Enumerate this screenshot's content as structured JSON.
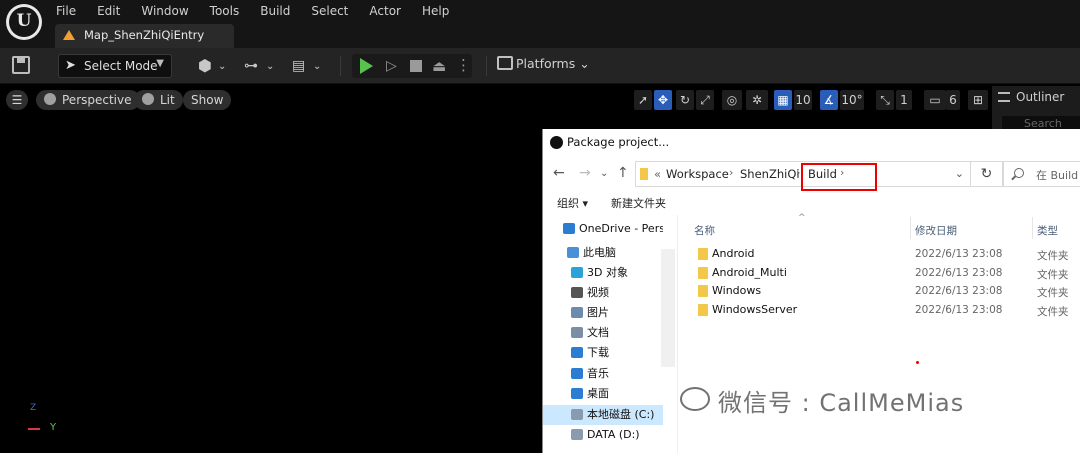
{
  "menu": [
    "File",
    "Edit",
    "Window",
    "Tools",
    "Build",
    "Select",
    "Actor",
    "Help"
  ],
  "level_tab": "Map_ShenZhiQiEntry",
  "toolbar": {
    "select_mode": "Select Mode",
    "platforms": "Platforms"
  },
  "viewport": {
    "perspective": "Perspective",
    "lit": "Lit",
    "show": "Show",
    "grid_snap": "10",
    "rotation_snap": "10°",
    "scale_snap": "1",
    "camera_speed": "6"
  },
  "outliner": {
    "title": "Outliner",
    "search_placeholder": "Search"
  },
  "axis": {
    "y": "Y",
    "z": "Z"
  },
  "dialog": {
    "title": "Package project...",
    "breadcrumb": [
      "«",
      "Workspace",
      "ShenZhiQi",
      "Build"
    ],
    "search_placeholder": "在 Build 中",
    "commands": {
      "organize": "组织 ▾",
      "new_folder": "新建文件夹"
    },
    "nav_pane": [
      {
        "label": "OneDrive - Persc",
        "icon": "cloud-icon",
        "color": "#2b7cd3"
      },
      {
        "label": "此电脑",
        "icon": "computer-icon",
        "color": "#4a90d9"
      },
      {
        "label": "3D 对象",
        "icon": "3d-objects-icon",
        "color": "#29a3d8"
      },
      {
        "label": "视频",
        "icon": "video-icon",
        "color": "#555555"
      },
      {
        "label": "图片",
        "icon": "pictures-icon",
        "color": "#6b8cae"
      },
      {
        "label": "文档",
        "icon": "documents-icon",
        "color": "#7a8ea4"
      },
      {
        "label": "下载",
        "icon": "download-icon",
        "color": "#2b7cd3"
      },
      {
        "label": "音乐",
        "icon": "music-icon",
        "color": "#2b7cd3"
      },
      {
        "label": "桌面",
        "icon": "desktop-icon",
        "color": "#2b7cd3"
      },
      {
        "label": "本地磁盘 (C:)",
        "icon": "drive-icon",
        "color": "#8a9bb0"
      },
      {
        "label": "DATA (D:)",
        "icon": "drive-icon",
        "color": "#8a9bb0"
      }
    ],
    "columns": {
      "name": "名称",
      "date": "修改日期",
      "type": "类型"
    },
    "files": [
      {
        "name": "Android",
        "date": "2022/6/13 23:08",
        "type": "文件夹"
      },
      {
        "name": "Android_Multi",
        "date": "2022/6/13 23:08",
        "type": "文件夹"
      },
      {
        "name": "Windows",
        "date": "2022/6/13 23:08",
        "type": "文件夹"
      },
      {
        "name": "WindowsServer",
        "date": "2022/6/13 23:08",
        "type": "文件夹"
      }
    ]
  },
  "watermark": "微信号 : CallMeMias"
}
